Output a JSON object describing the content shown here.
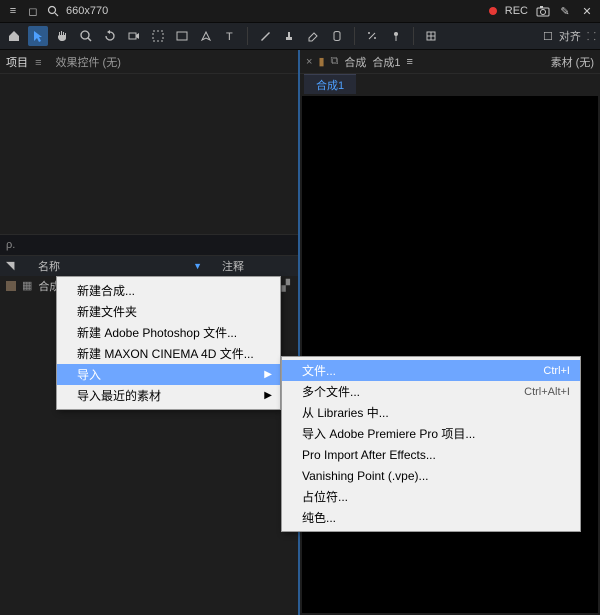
{
  "titlebar": {
    "search_text": "660x770",
    "rec_label": "REC"
  },
  "toolbar": {
    "align_label": "对齐"
  },
  "panels": {
    "project": {
      "tab_label": "项目",
      "tab_menu": "≡",
      "effects_label": "效果控件 (无)",
      "search_placeholder": "ρ.",
      "col_name": "名称",
      "col_comment": "注释",
      "row1_name": "合成 1"
    },
    "comp": {
      "marker_icon": "🔖",
      "comp_label": "合成",
      "comp_name": "合成1",
      "menu": "≡",
      "material_label": "素材 (无)",
      "tab1": "合成1"
    }
  },
  "ctx1": {
    "items": [
      "新建合成...",
      "新建文件夹",
      "新建 Adobe Photoshop 文件...",
      "新建 MAXON CINEMA 4D 文件...",
      "导入",
      "导入最近的素材"
    ]
  },
  "ctx2": {
    "items": [
      {
        "label": "文件...",
        "shortcut": "Ctrl+I"
      },
      {
        "label": "多个文件...",
        "shortcut": "Ctrl+Alt+I"
      },
      {
        "label": "从 Libraries 中...",
        "shortcut": ""
      },
      {
        "label": "导入 Adobe Premiere Pro 项目...",
        "shortcut": ""
      },
      {
        "label": "Pro Import After Effects...",
        "shortcut": ""
      },
      {
        "label": "Vanishing Point (.vpe)...",
        "shortcut": ""
      },
      {
        "label": "占位符...",
        "shortcut": ""
      },
      {
        "label": "纯色...",
        "shortcut": ""
      }
    ]
  }
}
